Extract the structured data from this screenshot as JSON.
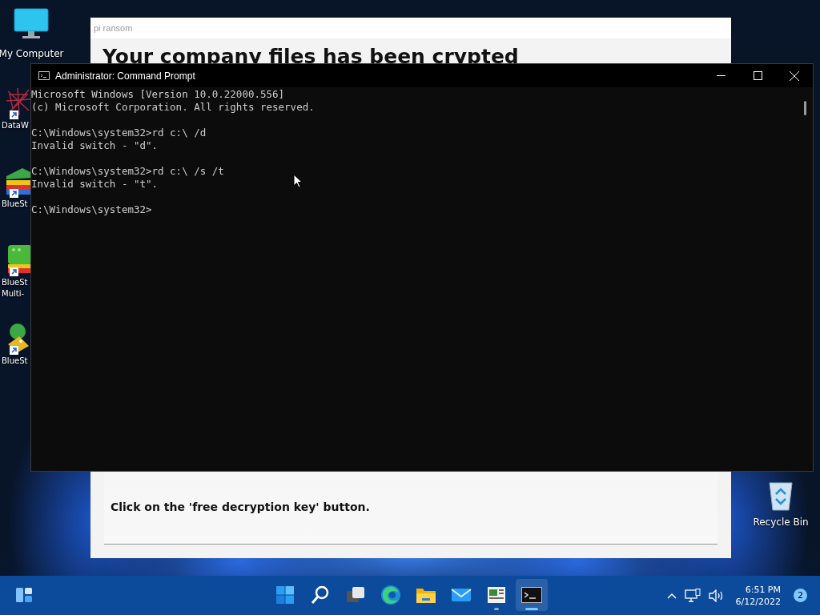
{
  "desktop_icons": [
    {
      "kind": "computer",
      "lines": [
        "My Computer"
      ],
      "shortcut": false
    },
    {
      "kind": "sketch",
      "lines": [
        "DataW"
      ],
      "shortcut": true
    },
    {
      "kind": "stack",
      "lines": [
        "BlueSt"
      ],
      "shortcut": true
    },
    {
      "kind": "multi",
      "lines": [
        "BlueSt",
        "Multi-"
      ],
      "shortcut": true
    },
    {
      "kind": "drop",
      "lines": [
        "BlueSt"
      ],
      "shortcut": true
    }
  ],
  "recycle_bin": {
    "label": "Recycle Bin"
  },
  "ransom_window": {
    "title": "pi ransom",
    "heading": "Your company files has been crypted",
    "lines": [
      "Click on the 'free decryption key' button."
    ]
  },
  "command_prompt": {
    "title": "Administrator: Command Prompt",
    "blocks": [
      [
        "Microsoft Windows [Version 10.0.22000.556]",
        "(c) Microsoft Corporation. All rights reserved."
      ],
      [
        "C:\\Windows\\system32>rd c:\\ /d",
        "Invalid switch - \"d\"."
      ],
      [
        "C:\\Windows\\system32>rd c:\\ /s /t",
        "Invalid switch - \"t\"."
      ],
      [
        "C:\\Windows\\system32>"
      ]
    ]
  },
  "taskbar": {
    "apps": [
      {
        "kind": "start",
        "running": false,
        "active": false
      },
      {
        "kind": "search",
        "running": false,
        "active": false
      },
      {
        "kind": "taskview",
        "running": false,
        "active": false
      },
      {
        "kind": "edge",
        "running": false,
        "active": false
      },
      {
        "kind": "folder",
        "running": false,
        "active": false
      },
      {
        "kind": "mail",
        "running": false,
        "active": false
      },
      {
        "kind": "news",
        "running": true,
        "active": false
      },
      {
        "kind": "terminal",
        "running": true,
        "active": true
      }
    ],
    "time": "6:51 PM",
    "date": "6/12/2022",
    "notifications": "2"
  }
}
